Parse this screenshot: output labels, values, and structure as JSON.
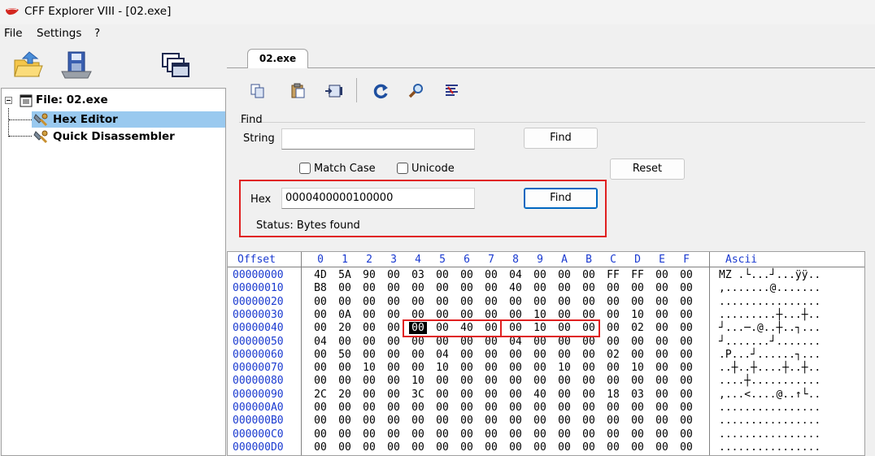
{
  "window": {
    "title": "CFF Explorer VIII - [02.exe]"
  },
  "menu": [
    "File",
    "Settings",
    "?"
  ],
  "toolbar_left": {
    "icons": [
      "open-folder-icon",
      "save-disk-icon",
      "windows-icon"
    ]
  },
  "tree": {
    "root_label": "File: 02.exe",
    "children": [
      {
        "label": "Hex Editor",
        "selected": true
      },
      {
        "label": "Quick Disassembler",
        "selected": false
      }
    ]
  },
  "tab": {
    "label": "02.exe"
  },
  "editor_toolbar": {
    "icons": [
      "copy-icon",
      "paste-icon",
      "insert-icon",
      "refresh-icon",
      "search-icon",
      "format-icon"
    ]
  },
  "find": {
    "legend": "Find",
    "string_label": "String",
    "string_value": "",
    "find_button": "Find",
    "match_case_label": "Match Case",
    "match_case_checked": false,
    "unicode_label": "Unicode",
    "unicode_checked": false,
    "reset_button": "Reset",
    "hex_label": "Hex",
    "hex_value": "0000400000100000",
    "hex_find_button": "Find",
    "status": "Status: Bytes found"
  },
  "hex_view": {
    "offset_header": "Offset",
    "column_headers": [
      "0",
      "1",
      "2",
      "3",
      "4",
      "5",
      "6",
      "7",
      "8",
      "9",
      "A",
      "B",
      "C",
      "D",
      "E",
      "F"
    ],
    "ascii_header": "Ascii",
    "selected_byte_offset": "00000044",
    "rows": [
      {
        "offset": "00000000",
        "bytes": [
          "4D",
          "5A",
          "90",
          "00",
          "03",
          "00",
          "00",
          "00",
          "04",
          "00",
          "00",
          "00",
          "FF",
          "FF",
          "00",
          "00"
        ],
        "ascii": "MZ .└...┘...ÿÿ.."
      },
      {
        "offset": "00000010",
        "bytes": [
          "B8",
          "00",
          "00",
          "00",
          "00",
          "00",
          "00",
          "00",
          "40",
          "00",
          "00",
          "00",
          "00",
          "00",
          "00",
          "00"
        ],
        "ascii": ",.......@......."
      },
      {
        "offset": "00000020",
        "bytes": [
          "00",
          "00",
          "00",
          "00",
          "00",
          "00",
          "00",
          "00",
          "00",
          "00",
          "00",
          "00",
          "00",
          "00",
          "00",
          "00"
        ],
        "ascii": "................"
      },
      {
        "offset": "00000030",
        "bytes": [
          "00",
          "0A",
          "00",
          "00",
          "00",
          "00",
          "00",
          "00",
          "00",
          "10",
          "00",
          "00",
          "00",
          "10",
          "00",
          "00"
        ],
        "ascii": ".........┼...┼.."
      },
      {
        "offset": "00000040",
        "bytes": [
          "00",
          "20",
          "00",
          "00",
          "00",
          "00",
          "40",
          "00",
          "00",
          "10",
          "00",
          "00",
          "00",
          "02",
          "00",
          "00"
        ],
        "ascii": "┘...─.@..┼..┐..."
      },
      {
        "offset": "00000050",
        "bytes": [
          "04",
          "00",
          "00",
          "00",
          "00",
          "00",
          "00",
          "00",
          "04",
          "00",
          "00",
          "00",
          "00",
          "00",
          "00",
          "00"
        ],
        "ascii": "┘.......┘......."
      },
      {
        "offset": "00000060",
        "bytes": [
          "00",
          "50",
          "00",
          "00",
          "00",
          "04",
          "00",
          "00",
          "00",
          "00",
          "00",
          "00",
          "02",
          "00",
          "00",
          "00"
        ],
        "ascii": ".P...┘......┐..."
      },
      {
        "offset": "00000070",
        "bytes": [
          "00",
          "00",
          "10",
          "00",
          "00",
          "10",
          "00",
          "00",
          "00",
          "00",
          "10",
          "00",
          "00",
          "10",
          "00",
          "00"
        ],
        "ascii": "..┼..┼....┼..┼.."
      },
      {
        "offset": "00000080",
        "bytes": [
          "00",
          "00",
          "00",
          "00",
          "10",
          "00",
          "00",
          "00",
          "00",
          "00",
          "00",
          "00",
          "00",
          "00",
          "00",
          "00"
        ],
        "ascii": "....┼..........."
      },
      {
        "offset": "00000090",
        "bytes": [
          "2C",
          "20",
          "00",
          "00",
          "3C",
          "00",
          "00",
          "00",
          "00",
          "40",
          "00",
          "00",
          "18",
          "03",
          "00",
          "00"
        ],
        "ascii": ",...<....@..↑└.."
      },
      {
        "offset": "000000A0",
        "bytes": [
          "00",
          "00",
          "00",
          "00",
          "00",
          "00",
          "00",
          "00",
          "00",
          "00",
          "00",
          "00",
          "00",
          "00",
          "00",
          "00"
        ],
        "ascii": "................"
      },
      {
        "offset": "000000B0",
        "bytes": [
          "00",
          "00",
          "00",
          "00",
          "00",
          "00",
          "00",
          "00",
          "00",
          "00",
          "00",
          "00",
          "00",
          "00",
          "00",
          "00"
        ],
        "ascii": "................"
      },
      {
        "offset": "000000C0",
        "bytes": [
          "00",
          "00",
          "00",
          "00",
          "00",
          "00",
          "00",
          "00",
          "00",
          "00",
          "00",
          "00",
          "00",
          "00",
          "00",
          "00"
        ],
        "ascii": "................"
      },
      {
        "offset": "000000D0",
        "bytes": [
          "00",
          "00",
          "00",
          "00",
          "00",
          "00",
          "00",
          "00",
          "00",
          "00",
          "00",
          "00",
          "00",
          "00",
          "00",
          "00"
        ],
        "ascii": "................"
      }
    ]
  },
  "colors": {
    "highlight": "#e02020",
    "offset_blue": "#1a3ad0",
    "selection": "#99c9ef"
  }
}
